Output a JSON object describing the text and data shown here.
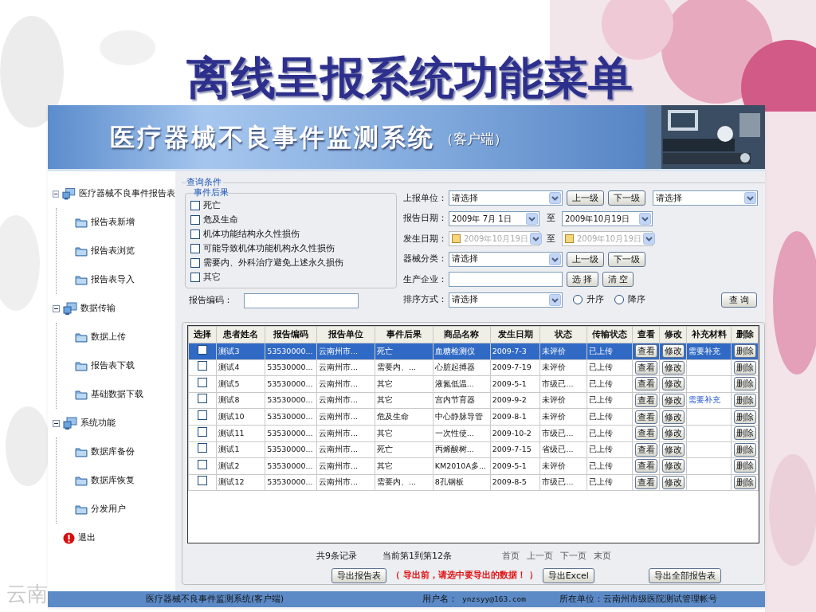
{
  "slide": {
    "title": "离线呈报系统功能菜单",
    "corner_text": "云南"
  },
  "app": {
    "title": "医疗器械不良事件监测系统",
    "subtitle": "（客户端）"
  },
  "sidebar": {
    "items": [
      {
        "label": "医疗器械不良事件报告表",
        "kind": "group",
        "expanded": true,
        "children": [
          {
            "label": "报告表新增"
          },
          {
            "label": "报告表浏览"
          },
          {
            "label": "报告表导入"
          }
        ]
      },
      {
        "label": "数据传输",
        "kind": "group",
        "expanded": true,
        "children": [
          {
            "label": "数据上传"
          },
          {
            "label": "报告表下载"
          },
          {
            "label": "基础数据下载"
          }
        ]
      },
      {
        "label": "系统功能",
        "kind": "group",
        "expanded": true,
        "children": [
          {
            "label": "数据库备份"
          },
          {
            "label": "数据库恢复"
          },
          {
            "label": "分发用户"
          }
        ]
      },
      {
        "label": "退出",
        "kind": "exit"
      }
    ]
  },
  "query": {
    "legend": "查询条件",
    "outcomes": {
      "legend": "事件后果",
      "options": [
        {
          "label": "死亡",
          "checked": false
        },
        {
          "label": "危及生命",
          "checked": false
        },
        {
          "label": "机体功能结构永久性损伤",
          "checked": false
        },
        {
          "label": "可能导致机体功能机构永久性损伤",
          "checked": false
        },
        {
          "label": "需要内、外科治疗避免上述永久损伤",
          "checked": false
        },
        {
          "label": "其它",
          "checked": false
        }
      ]
    },
    "report_code": {
      "label": "报告编码："
    },
    "fields": [
      {
        "kind": "select",
        "label": "上报单位：",
        "value": "请选择",
        "buttons": [
          "上一级",
          "下一级"
        ],
        "extra_select": "请选择"
      },
      {
        "kind": "date_range",
        "label": "报告日期：",
        "from": "2009年 7月 1日",
        "separator": "至",
        "to": "2009年10月19日",
        "disabled": false
      },
      {
        "kind": "date_range",
        "label": "发生日期：",
        "from": "2009年10月19日",
        "separator": "至",
        "to": "2009年10月19日",
        "disabled": true
      },
      {
        "kind": "select",
        "label": "器械分类：",
        "value": "请选择",
        "buttons": [
          "上一级",
          "下一级"
        ]
      },
      {
        "kind": "text",
        "label": "生产企业：",
        "buttons": [
          "选 择",
          "清 空"
        ]
      },
      {
        "kind": "sort",
        "label": "排序方式：",
        "value": "请选择",
        "radios": [
          {
            "label": "升序",
            "selected": false
          },
          {
            "label": "降序",
            "selected": false
          }
        ]
      }
    ],
    "submit": "查 询"
  },
  "table": {
    "columns": [
      "选择",
      "患者姓名",
      "报告编码",
      "报告单位",
      "事件后果",
      "商品名称",
      "发生日期",
      "状态",
      "传输状态",
      "查看",
      "修改",
      "补充材料",
      "删除"
    ],
    "rows": [
      {
        "selected": true,
        "checked": false,
        "cells": [
          "",
          "测试3",
          "53530000...",
          "云南州市...",
          "死亡",
          "血糖检测仪",
          "2009-7-3",
          "未评价",
          "已上传"
        ],
        "view": "查看",
        "edit": "修改",
        "supplement": "需要补充",
        "delete": "删除"
      },
      {
        "selected": false,
        "checked": false,
        "cells": [
          "",
          "测试4",
          "53530000...",
          "云南州市...",
          "需要内、...",
          "心脏起搏器",
          "2009-7-19",
          "未评价",
          "已上传"
        ],
        "view": "查看",
        "edit": "修改",
        "delete": "删除"
      },
      {
        "selected": false,
        "checked": false,
        "cells": [
          "",
          "测试5",
          "53530000...",
          "云南州市...",
          "其它",
          "液氮低温...",
          "2009-5-1",
          "市级已...",
          "已上传"
        ],
        "view": "查看",
        "edit": "修改",
        "delete": "删除"
      },
      {
        "selected": false,
        "checked": false,
        "cells": [
          "",
          "测试8",
          "53530000...",
          "云南州市...",
          "其它",
          "宫内节育器",
          "2009-9-2",
          "未评价",
          "已上传"
        ],
        "view": "查看",
        "edit": "修改",
        "supplement": "需要补充",
        "delete": "删除"
      },
      {
        "selected": false,
        "checked": false,
        "cells": [
          "",
          "测试10",
          "53530000...",
          "云南州市...",
          "危及生命",
          "中心静脉导管",
          "2009-8-1",
          "未评价",
          "已上传"
        ],
        "view": "查看",
        "edit": "修改",
        "delete": "删除"
      },
      {
        "selected": false,
        "checked": false,
        "cells": [
          "",
          "测试11",
          "53530000...",
          "云南州市...",
          "其它",
          "一次性使...",
          "2009-10-2",
          "市级已...",
          "已上传"
        ],
        "view": "查看",
        "edit": "修改",
        "delete": "删除"
      },
      {
        "selected": false,
        "checked": false,
        "cells": [
          "",
          "测试1",
          "53530000...",
          "云南州市...",
          "死亡",
          "丙烯酸树...",
          "2009-7-15",
          "省级已...",
          "已上传"
        ],
        "view": "查看",
        "edit": "修改",
        "delete": "删除"
      },
      {
        "selected": false,
        "checked": false,
        "cells": [
          "",
          "测试2",
          "53530000...",
          "云南州市...",
          "其它",
          "KM2010A多...",
          "2009-5-1",
          "未评价",
          "已上传"
        ],
        "view": "查看",
        "edit": "修改",
        "delete": "删除"
      },
      {
        "selected": false,
        "checked": false,
        "cells": [
          "",
          "测试12",
          "53530000...",
          "云南州市...",
          "需要内、...",
          "8孔钢板",
          "2009-8-5",
          "市级已...",
          "已上传"
        ],
        "view": "查看",
        "edit": "修改",
        "delete": "删除"
      }
    ]
  },
  "pager": {
    "total": "共9条记录",
    "range": "当前第1到第12条",
    "links": [
      "首页",
      "上一页",
      "下一页",
      "末页"
    ]
  },
  "export": {
    "report_button": "导出报告表",
    "note": "（ 导出前，请选中要导出的数据！ ）",
    "excel_button": "导出Excel",
    "all_button": "导出全部报告表"
  },
  "status_bar": {
    "app_name": "医疗器械不良事件监测系统(客户端)",
    "user_label": "用户名：",
    "user": "ynzsyy@163.com",
    "unit": "所在单位：云南州市级医院测试管理帐号"
  }
}
